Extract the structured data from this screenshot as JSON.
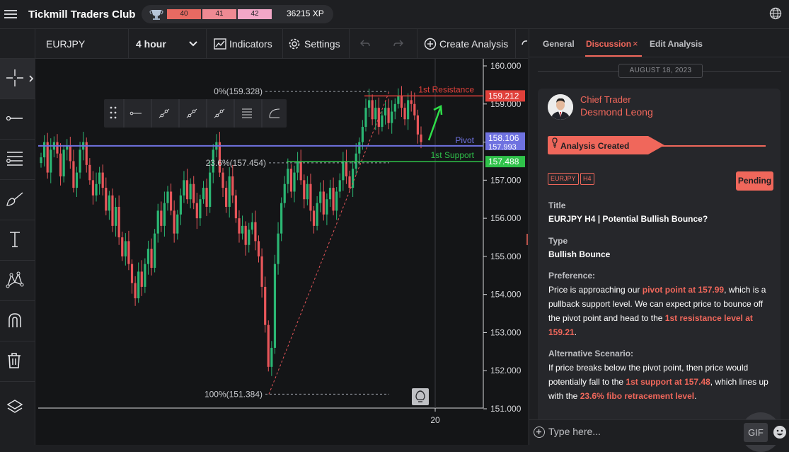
{
  "app": {
    "title": "Tickmill Traders Club"
  },
  "xp": {
    "level_a": "40",
    "level_b": "41",
    "level_c": "42",
    "points": "36215 XP",
    "colors": {
      "a": "#e86a62",
      "b": "#ef8a93",
      "c": "#f2a7c7"
    }
  },
  "toolbar": {
    "symbol": "EURJPY",
    "timeframe": "4 hour",
    "indicators_label": "Indicators",
    "settings_label": "Settings",
    "create_analysis_label": "Create Analysis"
  },
  "chart_data": {
    "type": "candlestick",
    "ylim": [
      151.0,
      160.0
    ],
    "y_ticks": [
      "160.000",
      "159.000",
      "158.000",
      "157.000",
      "156.000",
      "155.000",
      "154.000",
      "153.000",
      "152.000",
      "151.000"
    ],
    "x_tick_label": "20",
    "levels": [
      {
        "name": "1st Resistance",
        "value": 159.212,
        "label": "159.212",
        "color": "#e0403a"
      },
      {
        "name": "Pivot",
        "value": 158.106,
        "label": "158.106",
        "color": "#6f72e0"
      },
      {
        "name": "1st Support",
        "value": 157.488,
        "label": "157.488",
        "color": "#2fc24a"
      }
    ],
    "pivot_price": 157.993,
    "pivot_price_label": "157.993",
    "fib_levels": [
      {
        "label": "0%(159.328)",
        "value": 159.328
      },
      {
        "label": "23.6%(157.454)",
        "value": 157.454
      },
      {
        "label": "100%(151.384)",
        "value": 151.384
      }
    ],
    "bull_color": "#2bb673",
    "bear_color": "#e8565a",
    "path": [
      157.6,
      158.0,
      157.2,
      157.8,
      158.0,
      157.7,
      157.1,
      157.8,
      157.9,
      157.5,
      156.8,
      157.2,
      157.8,
      158.0,
      157.4,
      157.0,
      156.6,
      156.9,
      157.2,
      156.8,
      156.2,
      156.6,
      155.8,
      156.3,
      155.5,
      155.0,
      155.4,
      154.8,
      154.3,
      153.9,
      154.6,
      154.2,
      154.8,
      155.2,
      154.7,
      155.6,
      156.2,
      155.8,
      156.4,
      156.7,
      156.2,
      155.6,
      156.1,
      156.6,
      157.0,
      156.5,
      156.9,
      156.4,
      156.0,
      156.5,
      156.8,
      156.3,
      157.2,
      157.8,
      158.0,
      157.2,
      156.8,
      156.3,
      157.1,
      156.6,
      156.0,
      155.6,
      155.8,
      155.3,
      155.7,
      155.9,
      155.4,
      155.0,
      154.2,
      153.2,
      152.1,
      152.6,
      154.8,
      155.6,
      156.4,
      156.9,
      157.3,
      156.7,
      157.2,
      157.5,
      157.0,
      156.5,
      156.9,
      156.2,
      155.8,
      156.4,
      156.7,
      156.1,
      156.5,
      156.8,
      156.2,
      156.7,
      157.0,
      157.5,
      157.1,
      156.8,
      157.3,
      157.7,
      158.0,
      158.4,
      158.9,
      159.1,
      158.6,
      158.9,
      158.4,
      158.7,
      158.9,
      158.5,
      158.8,
      159.0,
      159.2,
      158.9,
      158.6,
      159.1,
      159.0,
      158.7,
      158.2,
      158.0
    ]
  },
  "right_panel": {
    "tabs": [
      "General",
      "Discussion",
      "Edit Analysis"
    ],
    "date": "AUGUST 18, 2023",
    "author_role": "Chief Trader",
    "author_name": "Desmond Leong",
    "status_event": "Analysis Created",
    "tags": [
      "EURJPY",
      "H4"
    ],
    "status": "Pending",
    "title_label": "Title",
    "title": "EURJPY H4 | Potential Bullish Bounce?",
    "type_label": "Type",
    "type": "Bullish Bounce",
    "preference_label": "Preference:",
    "pref_p1": "Price is approaching our ",
    "pref_h1": "pivot point at 157.99",
    "pref_p2": ", which is a pullback support level. We can expect price to bounce off the pivot point and head to the ",
    "pref_h2": "1st resistance level at 159.21",
    "pref_p3": ".",
    "alt_label": "Alternative Scenario:",
    "alt_p1": "If price breaks below the pivot point, then price would potentially fall to the ",
    "alt_h1": "1st support at 157.48",
    "alt_p2": ", which lines up with the ",
    "alt_h2": "23.6% fibo retracement level",
    "alt_p3": ".",
    "input_placeholder": "Type here...",
    "gif_label": "GIF"
  }
}
